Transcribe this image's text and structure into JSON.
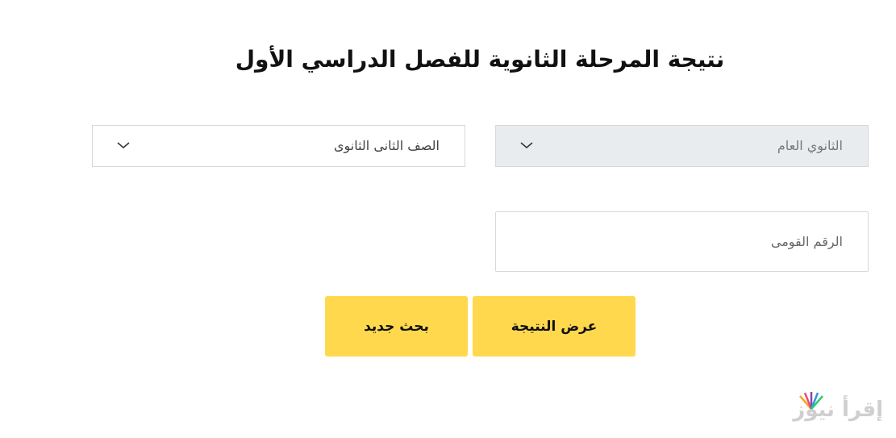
{
  "page": {
    "title": "نتيجة المرحلة الثانوية للفصل الدراسي الأول"
  },
  "form": {
    "type_select": {
      "selected": "الثانوي العام",
      "icon": "chevron-down-icon"
    },
    "grade_select": {
      "selected": "الصف الثانى الثانوى",
      "icon": "chevron-down-icon"
    },
    "national_id": {
      "placeholder": "الرقم القومى",
      "value": ""
    },
    "buttons": {
      "show_result": "عرض النتيجة",
      "new_search": "بحث جديد"
    }
  },
  "watermark": {
    "text": "إقرأ نيوز"
  },
  "colors": {
    "button_bg": "#ffd84d",
    "disabled_select_bg": "#e9ecef",
    "border": "#d8d8d8"
  }
}
